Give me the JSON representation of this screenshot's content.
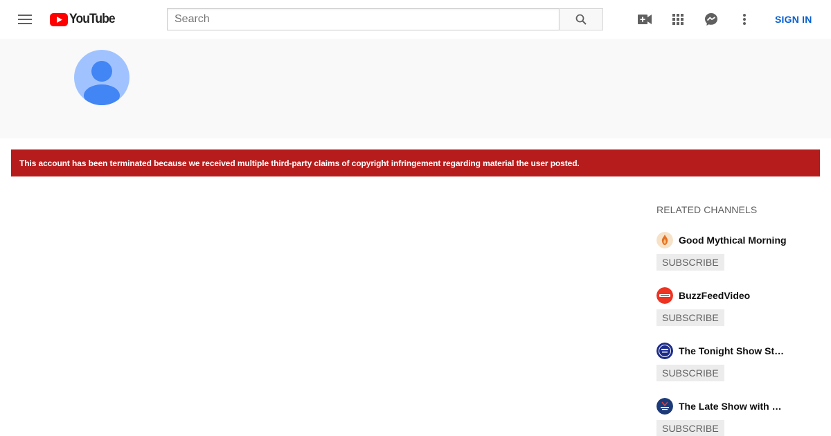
{
  "header": {
    "logo_text": "YouTube",
    "search_placeholder": "Search",
    "signin_label": "SIGN IN",
    "icons": [
      "menu-icon",
      "search-icon",
      "create-video-icon",
      "apps-grid-icon",
      "messages-icon",
      "more-vert-icon"
    ]
  },
  "channel": {
    "avatar_icon": "default-avatar-icon"
  },
  "alert": {
    "message": "This account has been terminated because we received multiple third-party claims of copyright infringement regarding material the user posted."
  },
  "related": {
    "title": "RELATED CHANNELS",
    "channels": [
      {
        "name": "Good Mythical Morning",
        "subscribe_label": "SUBSCRIBE"
      },
      {
        "name": "BuzzFeedVideo",
        "subscribe_label": "SUBSCRIBE"
      },
      {
        "name": "The Tonight Show Starring Jimmy Fallon",
        "subscribe_label": "SUBSCRIBE"
      },
      {
        "name": "The Late Show with Stephen Colbert",
        "subscribe_label": "SUBSCRIBE"
      }
    ]
  },
  "colors": {
    "brand_red": "#ff0000",
    "alert_red": "#b71c1c",
    "link_blue": "#065fd4",
    "avatar_light": "#a0c3ff",
    "avatar_dark": "#4285f4"
  }
}
